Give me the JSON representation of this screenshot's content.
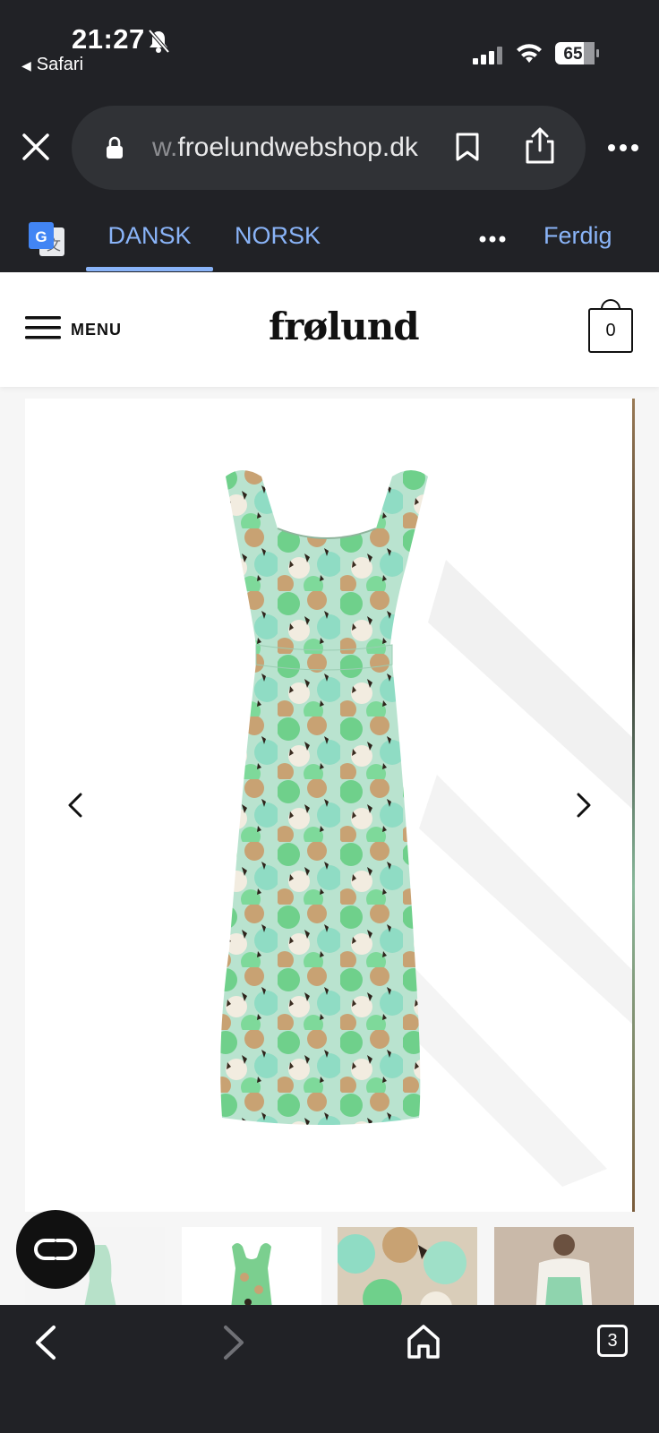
{
  "status_bar": {
    "time": "21:27",
    "back_app": "Safari",
    "battery": "65"
  },
  "browser": {
    "url_prefix": "w.",
    "url_domain": "froelundwebshop.dk"
  },
  "translate_bar": {
    "languages": [
      "DANSK",
      "NORSK"
    ],
    "active_language": "DANSK",
    "done_label": "Ferdig"
  },
  "site": {
    "menu_label": "MENU",
    "logo_text": "frølund",
    "cart_count": "0"
  },
  "product_gallery": {
    "main_image": "floral-midi-dress",
    "thumbnails": [
      "dress-front-small",
      "dress-front",
      "fabric-print-closeup",
      "model-wearing-dress"
    ]
  },
  "bottom_nav": {
    "tab_count": "3"
  },
  "colors": {
    "browser_chrome": "#212226",
    "accent_blue": "#8ab4f8",
    "dress_green": "#6fd08b",
    "dress_mint": "#8fdcc4",
    "dress_tan": "#c8a273"
  }
}
